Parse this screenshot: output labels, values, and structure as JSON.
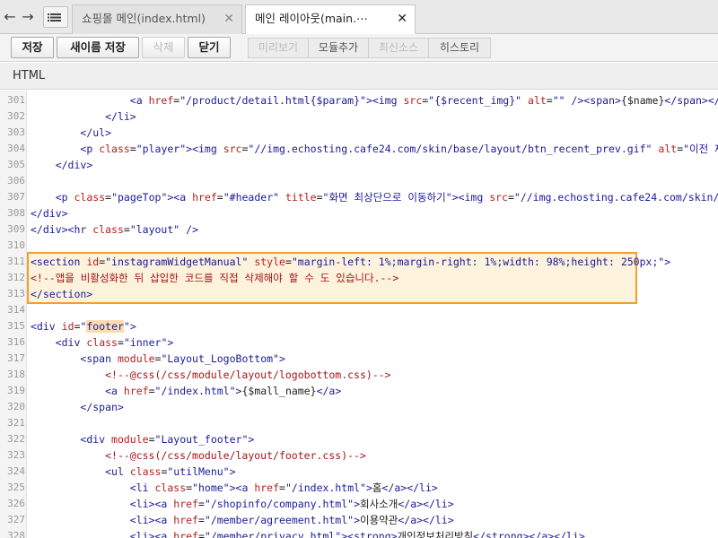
{
  "tabs": [
    {
      "label": "쇼핑몰 메인(index.html)",
      "active": false
    },
    {
      "label": "메인 레이아웃(main.⋯",
      "active": true
    }
  ],
  "toolbar": {
    "save": "저장",
    "save_as": "새이름 저장",
    "delete": "삭제",
    "close": "닫기",
    "preview": "미리보기",
    "add_module": "모듈추가",
    "latest_source": "최신소스",
    "history": "히스토리"
  },
  "section_title": "HTML",
  "code_lines": [
    {
      "n": "301",
      "html": "                <span class=\"tag\">&lt;a</span> <span class=\"attr\">href</span>=<span class=\"val\">\"/product/detail.html{$param}\"</span><span class=\"tag\">&gt;&lt;img</span> <span class=\"attr\">src</span>=<span class=\"val\">\"{$recent_img}\"</span> <span class=\"attr\">alt</span>=<span class=\"val\">\"\"</span> <span class=\"tag\">/&gt;&lt;span&gt;</span>{$name}<span class=\"tag\">&lt;/span&gt;&lt;/a&gt;</span>"
    },
    {
      "n": "302",
      "html": "            <span class=\"tag\">&lt;/li&gt;</span>"
    },
    {
      "n": "303",
      "html": "        <span class=\"tag\">&lt;/ul&gt;</span>"
    },
    {
      "n": "304",
      "html": "        <span class=\"tag\">&lt;p</span> <span class=\"attr\">class</span>=<span class=\"val\">\"player\"</span><span class=\"tag\">&gt;&lt;img</span> <span class=\"attr\">src</span>=<span class=\"val\">\"//img.echosting.cafe24.com/skin/base/layout/btn_recent_prev.gif\"</span> <span class=\"attr\">alt</span>=<span class=\"val\">\"이전 제품\"</span>"
    },
    {
      "n": "305",
      "html": "    <span class=\"tag\">&lt;/div&gt;</span>"
    },
    {
      "n": "306",
      "html": ""
    },
    {
      "n": "307",
      "html": "    <span class=\"tag\">&lt;p</span> <span class=\"attr\">class</span>=<span class=\"val\">\"pageTop\"</span><span class=\"tag\">&gt;&lt;a</span> <span class=\"attr\">href</span>=<span class=\"val\">\"#header\"</span> <span class=\"attr\">title</span>=<span class=\"val\">\"화면 최상단으로 이동하기\"</span><span class=\"tag\">&gt;&lt;img</span> <span class=\"attr\">src</span>=<span class=\"val\">\"//img.echosting.cafe24.com/skin/b</span>"
    },
    {
      "n": "308",
      "html": "<span class=\"tag\">&lt;/div&gt;</span>"
    },
    {
      "n": "309",
      "html": "<span class=\"tag\">&lt;/div&gt;&lt;hr</span> <span class=\"attr\">class</span>=<span class=\"val\">\"layout\"</span> <span class=\"tag\">/&gt;</span>"
    },
    {
      "n": "310",
      "html": ""
    },
    {
      "n": "311",
      "html": "<span class=\"tag\">&lt;section</span> <span class=\"attr\">id</span>=<span class=\"val\">\"instagramWidgetManual\"</span> <span class=\"attr\">style</span>=<span class=\"val\">\"margin-left: 1%;margin-right: 1%;width: 98%;height: 250px;\"</span><span class=\"tag\">&gt;</span>"
    },
    {
      "n": "312",
      "html": "<span class=\"cmt\">&lt;!--앱을 비활성화한 뒤 삽입한 코드를 직접 삭제해야 할 수 도 있습니다.--&gt;</span>"
    },
    {
      "n": "313",
      "html": "<span class=\"tag\">&lt;/section&gt;</span>"
    },
    {
      "n": "314",
      "html": ""
    },
    {
      "n": "315",
      "html": "<span class=\"tag\">&lt;div</span> <span class=\"attr\">id</span>=<span class=\"val\">\"<span class=\"word-hl\">footer</span>\"</span><span class=\"tag\">&gt;</span>"
    },
    {
      "n": "316",
      "html": "    <span class=\"tag\">&lt;div</span> <span class=\"attr\">class</span>=<span class=\"val\">\"inner\"</span><span class=\"tag\">&gt;</span>"
    },
    {
      "n": "317",
      "html": "        <span class=\"tag\">&lt;span</span> <span class=\"attr\">module</span>=<span class=\"val\">\"Layout_LogoBottom\"</span><span class=\"tag\">&gt;</span>"
    },
    {
      "n": "318",
      "html": "            <span class=\"cmt\">&lt;!--@css(/css/module/layout/logobottom.css)--&gt;</span>"
    },
    {
      "n": "319",
      "html": "            <span class=\"tag\">&lt;a</span> <span class=\"attr\">href</span>=<span class=\"val\">\"/index.html\"</span><span class=\"tag\">&gt;</span>{$mall_name}<span class=\"tag\">&lt;/a&gt;</span>"
    },
    {
      "n": "320",
      "html": "        <span class=\"tag\">&lt;/span&gt;</span>"
    },
    {
      "n": "321",
      "html": ""
    },
    {
      "n": "322",
      "html": "        <span class=\"tag\">&lt;div</span> <span class=\"attr\">module</span>=<span class=\"val\">\"Layout_footer\"</span><span class=\"tag\">&gt;</span>"
    },
    {
      "n": "323",
      "html": "            <span class=\"cmt\">&lt;!--@css(/css/module/layout/footer.css)--&gt;</span>"
    },
    {
      "n": "324",
      "html": "            <span class=\"tag\">&lt;ul</span> <span class=\"attr\">class</span>=<span class=\"val\">\"utilMenu\"</span><span class=\"tag\">&gt;</span>"
    },
    {
      "n": "325",
      "html": "                <span class=\"tag\">&lt;li</span> <span class=\"attr\">class</span>=<span class=\"val\">\"home\"</span><span class=\"tag\">&gt;&lt;a</span> <span class=\"attr\">href</span>=<span class=\"val\">\"/index.html\"</span><span class=\"tag\">&gt;</span>홈<span class=\"tag\">&lt;/a&gt;&lt;/li&gt;</span>"
    },
    {
      "n": "326",
      "html": "                <span class=\"tag\">&lt;li&gt;&lt;a</span> <span class=\"attr\">href</span>=<span class=\"val\">\"/shopinfo/company.html\"</span><span class=\"tag\">&gt;</span>회사소개<span class=\"tag\">&lt;/a&gt;&lt;/li&gt;</span>"
    },
    {
      "n": "327",
      "html": "                <span class=\"tag\">&lt;li&gt;&lt;a</span> <span class=\"attr\">href</span>=<span class=\"val\">\"/member/agreement.html\"</span><span class=\"tag\">&gt;</span>이용약관<span class=\"tag\">&lt;/a&gt;&lt;/li&gt;</span>"
    },
    {
      "n": "328",
      "html": "                <span class=\"tag\">&lt;li&gt;&lt;a</span> <span class=\"attr\">href</span>=<span class=\"val\">\"/member/privacy.html\"</span><span class=\"tag\">&gt;&lt;strong&gt;</span>개인정보처리방침<span class=\"tag\">&lt;/strong&gt;&lt;/a&gt;&lt;/li&gt;</span>"
    }
  ]
}
